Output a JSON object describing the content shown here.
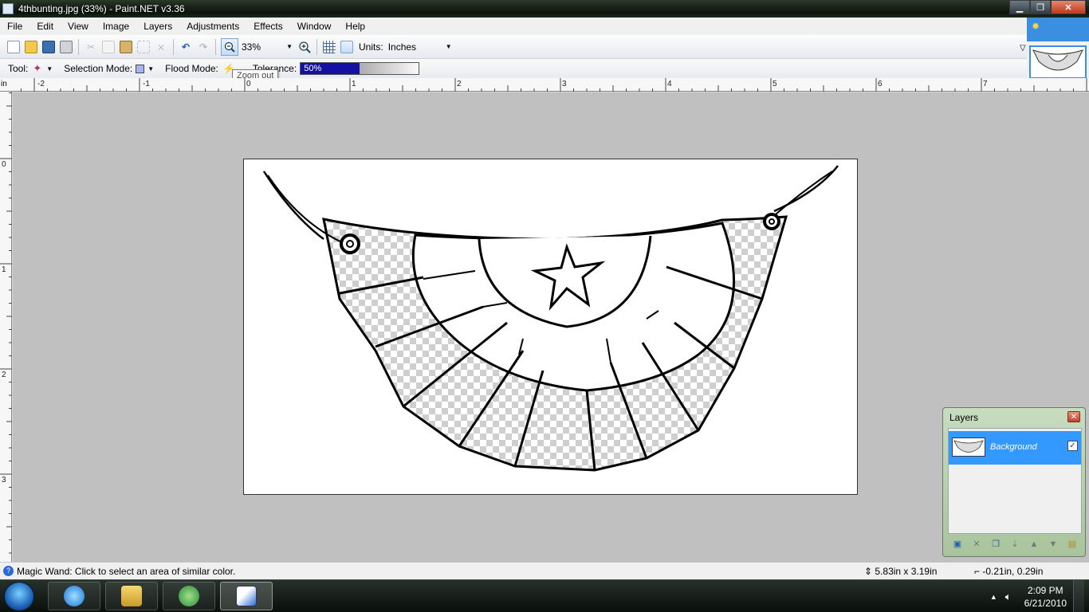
{
  "window": {
    "title": "4thbunting.jpg (33%) - Paint.NET v3.36",
    "min_label": "▁",
    "max_label": "❐",
    "close_label": "✕"
  },
  "menu": [
    "File",
    "Edit",
    "View",
    "Image",
    "Layers",
    "Adjustments",
    "Effects",
    "Window",
    "Help"
  ],
  "toolbar": {
    "zoom_value": "33%",
    "units_label": "Units:",
    "units_value": "Inches",
    "icons": [
      "new-icon",
      "open-icon",
      "save-icon",
      "print-icon",
      "cut-icon",
      "copy-icon",
      "paste-icon",
      "crop-icon",
      "deselect-icon",
      "undo-icon",
      "redo-icon",
      "zoom-out-icon",
      "zoom-in-icon",
      "grid-icon",
      "rulers-icon"
    ]
  },
  "tool_options": {
    "tool_label": "Tool:",
    "selection_mode_label": "Selection Mode:",
    "flood_mode_label": "Flood Mode:",
    "tolerance_label": "Tolerance:",
    "tolerance_value": "50%",
    "tolerance_fraction": 0.5
  },
  "tooltip": "Zoom out",
  "ruler": {
    "unit": "in",
    "h_labels": [
      "-2",
      "-1",
      "0",
      "1",
      "2",
      "3",
      "4",
      "5",
      "6",
      "7"
    ],
    "v_labels": [
      "0",
      "1",
      "2",
      "3"
    ]
  },
  "layers_panel": {
    "title": "Layers",
    "close_label": "✕",
    "layers": [
      {
        "name": "Background",
        "visible": true,
        "selected": true
      }
    ],
    "tools": [
      "add-layer-icon",
      "delete-layer-icon",
      "duplicate-layer-icon",
      "merge-layer-down-icon",
      "move-layer-up-icon",
      "move-layer-down-icon",
      "layer-properties-icon"
    ]
  },
  "status": {
    "help_text": "Magic Wand: Click to select an area of similar color.",
    "image_size": "5.83in x 3.19in",
    "cursor_pos": "-0.21in, 0.29in"
  },
  "taskbar": {
    "time": "2:09 PM",
    "date": "6/21/2010",
    "apps": [
      "internet-explorer-icon",
      "windows-explorer-icon",
      "messenger-icon",
      "paint-net-icon"
    ]
  },
  "colors": {
    "accent": "#3399ff",
    "tolerance_fill": "#1410a2",
    "canvas_bg": "#c0c0c0"
  }
}
